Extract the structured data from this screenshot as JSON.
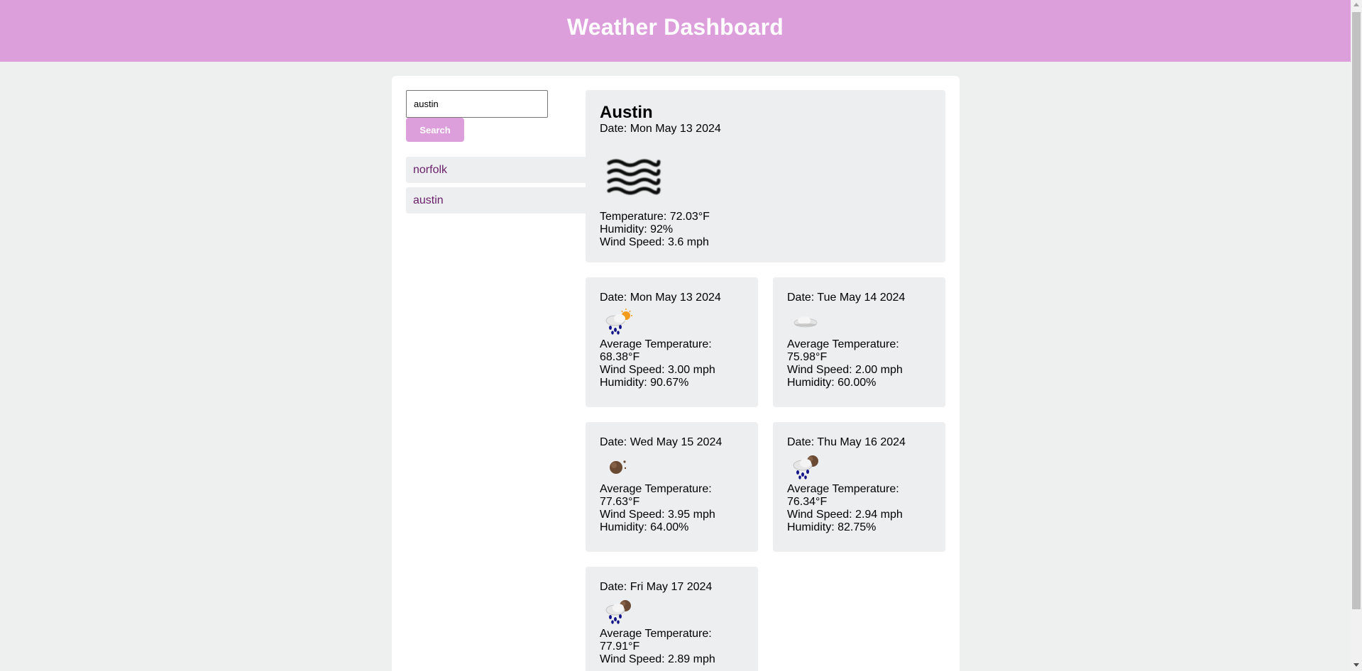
{
  "header": {
    "title": "Weather Dashboard"
  },
  "search": {
    "value": "austin",
    "placeholder": "",
    "button_label": "Search"
  },
  "history": [
    "norfolk",
    "austin"
  ],
  "current": {
    "city": "Austin",
    "date": "Date: Mon May 13 2024",
    "icon": "mist-icon",
    "temperature": "Temperature: 72.03°F",
    "humidity": "Humidity: 92%",
    "wind": "Wind Speed: 3.6 mph"
  },
  "forecast": [
    {
      "date": "Date: Mon May 13 2024",
      "icon": "rain-sun-icon",
      "avg_label": "Average Temperature:",
      "avg_value": "68.38°F",
      "wind": "Wind Speed: 3.00 mph",
      "humidity": "Humidity: 90.67%"
    },
    {
      "date": "Date: Tue May 14 2024",
      "icon": "cloud-icon",
      "avg_label": "Average Temperature:",
      "avg_value": "75.98°F",
      "wind": "Wind Speed: 2.00 mph",
      "humidity": "Humidity: 60.00%"
    },
    {
      "date": "Date: Wed May 15 2024",
      "icon": "moon-icon",
      "avg_label": "Average Temperature:",
      "avg_value": "77.63°F",
      "wind": "Wind Speed: 3.95 mph",
      "humidity": "Humidity: 64.00%"
    },
    {
      "date": "Date: Thu May 16 2024",
      "icon": "rain-moon-icon",
      "avg_label": "Average Temperature:",
      "avg_value": "76.34°F",
      "wind": "Wind Speed: 2.94 mph",
      "humidity": "Humidity: 82.75%"
    },
    {
      "date": "Date: Fri May 17 2024",
      "icon": "rain-moon-icon",
      "avg_label": "Average Temperature:",
      "avg_value": "77.91°F",
      "wind": "Wind Speed: 2.89 mph",
      "humidity": ""
    }
  ],
  "colors": {
    "accent": "#dc9fdc",
    "history_text": "#6b1f6b",
    "card_bg": "#eceeef",
    "page_bg": "#eeefef"
  }
}
